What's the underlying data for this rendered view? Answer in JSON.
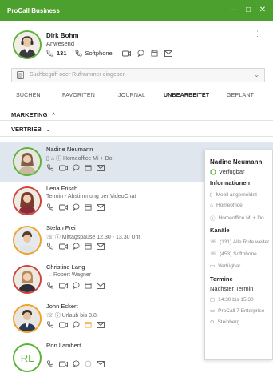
{
  "app": {
    "title": "ProCall Business"
  },
  "window_buttons": {
    "minimize": "—",
    "maximize": "□",
    "close": "✕"
  },
  "me": {
    "name": "Dirk Bohm",
    "status": "Anwesend",
    "extension": "131",
    "softphone": "Softphone",
    "avatar_icon": "headset-agent-avatar"
  },
  "search": {
    "placeholder": "Suchbegriff oder Rufnummer eingeben"
  },
  "tabs": [
    "SUCHEN",
    "FAVORITEN",
    "JOURNAL",
    "UNBEARBEITET",
    "GEPLANT"
  ],
  "groups": {
    "marketing": "MARKETING",
    "vertrieb": "VERTRIEB",
    "marketing_chevron": "^",
    "vertrieb_chevron": "v"
  },
  "contacts": [
    {
      "name": "Nadine Neumann",
      "sub": "Homeoffice Mi + Do",
      "ring": "green"
    },
    {
      "name": "Lena Frisch",
      "sub": "Termin - Abstimmung per VideoChat",
      "ring": "red"
    },
    {
      "name": "Stefan Frei",
      "sub": "Mittagspause 12.30 - 13.30 Uhr",
      "ring": "orange"
    },
    {
      "name": "Christine Lang",
      "sub": "→ Robert Wagner",
      "ring": "red"
    },
    {
      "name": "John Eckert",
      "sub": "Urlaub bis 3.8.",
      "ring": "orange"
    },
    {
      "name": "Ron Lambert",
      "sub": "",
      "ring": "green",
      "initials": "RL"
    }
  ],
  "popup": {
    "name": "Nadine Neumann",
    "status": "Verfügbar",
    "info_title": "Informationen",
    "info_items": [
      "Mobil angemeldet",
      "Homeoffice",
      "Homeoffice Mi + Do"
    ],
    "channels_title": "Kanäle",
    "channel_items": [
      "(131) Alle Rufe weiter",
      "(453) Softphone",
      "Verfügbar"
    ],
    "appointments_title": "Termine",
    "next_label": "Nächster Termin",
    "appointment_items": [
      "14:30 bis 15:30",
      "ProCall 7 Enterprise",
      "Steinberg"
    ]
  },
  "colors": {
    "brand_green": "#4ca02d",
    "ring_green": "#5cb33b",
    "ring_red": "#d0433a",
    "ring_orange": "#f0a12a",
    "selected_row": "#dfe6ee"
  }
}
